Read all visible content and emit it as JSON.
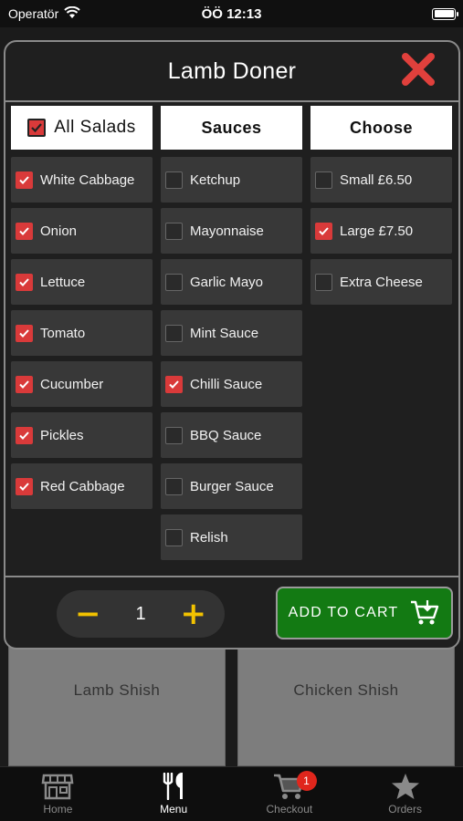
{
  "status_bar": {
    "carrier": "Operatör",
    "time": "ÖÖ 12:13"
  },
  "background": {
    "cards": [
      {
        "label": "Lamb Shish"
      },
      {
        "label": "Chicken Shish"
      }
    ]
  },
  "modal": {
    "title": "Lamb Doner",
    "columns": {
      "salads": {
        "header": "All Salads",
        "header_checked": true,
        "options": [
          {
            "label": "White Cabbage",
            "checked": true
          },
          {
            "label": "Onion",
            "checked": true
          },
          {
            "label": "Lettuce",
            "checked": true
          },
          {
            "label": "Tomato",
            "checked": true
          },
          {
            "label": "Cucumber",
            "checked": true
          },
          {
            "label": "Pickles",
            "checked": true
          },
          {
            "label": "Red Cabbage",
            "checked": true
          }
        ]
      },
      "sauces": {
        "header": "Sauces",
        "options": [
          {
            "label": "Ketchup",
            "checked": false
          },
          {
            "label": "Mayonnaise",
            "checked": false
          },
          {
            "label": "Garlic Mayo",
            "checked": false
          },
          {
            "label": "Mint Sauce",
            "checked": false
          },
          {
            "label": "Chilli Sauce",
            "checked": true
          },
          {
            "label": "BBQ Sauce",
            "checked": false
          },
          {
            "label": "Burger Sauce",
            "checked": false
          },
          {
            "label": "Relish",
            "checked": false
          }
        ]
      },
      "choose": {
        "header": "Choose",
        "options": [
          {
            "label": "Small £6.50",
            "checked": false
          },
          {
            "label": "Large £7.50",
            "checked": true
          },
          {
            "label": "Extra Cheese",
            "checked": false
          }
        ]
      }
    },
    "quantity": {
      "minus": "−",
      "value": "1",
      "plus": "+"
    },
    "add_to_cart": "ADD TO CART"
  },
  "tab_bar": {
    "tabs": [
      {
        "label": "Home",
        "icon": "store-icon"
      },
      {
        "label": "Menu",
        "icon": "fork-knife-icon",
        "active": true
      },
      {
        "label": "Checkout",
        "icon": "cart-icon",
        "badge": "1"
      },
      {
        "label": "Orders",
        "icon": "star-icon"
      }
    ]
  },
  "colors": {
    "checked": "#d93a3a",
    "add_to_cart": "#137a13",
    "quantity_buttons": "#f2c200",
    "close": "#e0403c",
    "badge": "#e0261c"
  }
}
